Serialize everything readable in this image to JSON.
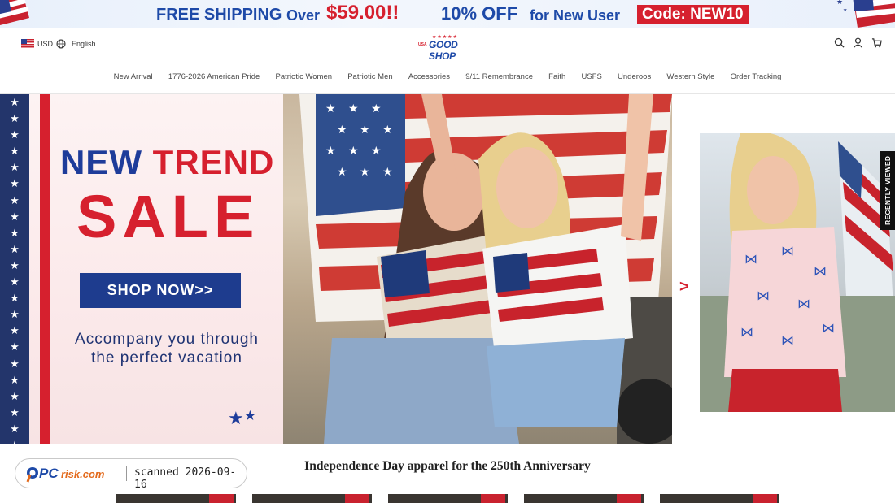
{
  "promo": {
    "part1": "FREE SHIPPING",
    "part2": "Over",
    "price": "$59.00!!",
    "part3": "10% OFF",
    "part4": "for New User",
    "code": "Code: NEW10"
  },
  "header": {
    "currency": "USD",
    "language": "English",
    "logo_text": "GOOD SHOP",
    "logo_badge": "USA",
    "icons": [
      "search-icon",
      "account-icon",
      "cart-icon"
    ]
  },
  "nav": [
    "New Arrival",
    "1776-2026 American Pride",
    "Patriotic Women",
    "Patriotic Men",
    "Accessories",
    "9/11 Remembrance",
    "Faith",
    "USFS",
    "Underoos",
    "Western Style",
    "Order Tracking"
  ],
  "hero": {
    "title_word1": "NEW",
    "title_word2": "TREND",
    "title_big": "SALE",
    "button": "SHOP NOW>>",
    "subtitle_line1": "Accompany you through",
    "subtitle_line2": "the perfect vacation",
    "next_arrow": ">"
  },
  "recently_viewed": "RECENTLY VIEWED",
  "section": {
    "title": "Independence Day apparel for the 250th Anniversary"
  },
  "watermark": {
    "brand": "PCrisk.com",
    "scanned": "scanned 2026-09-16"
  },
  "colors": {
    "brand_blue": "#1e3c9a",
    "brand_red": "#d6202e",
    "navy": "#23356b"
  }
}
